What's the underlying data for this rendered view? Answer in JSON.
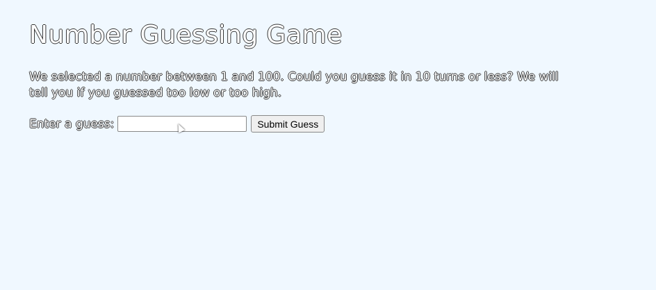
{
  "title": "Number Guessing Game",
  "intro": "We selected a number between 1 and 100. Could you guess it in 10 turns or less? We will tell you if you guessed too low or too high.",
  "form": {
    "label": "Enter a guess:",
    "value": "",
    "submit_label": "Submit Guess"
  }
}
